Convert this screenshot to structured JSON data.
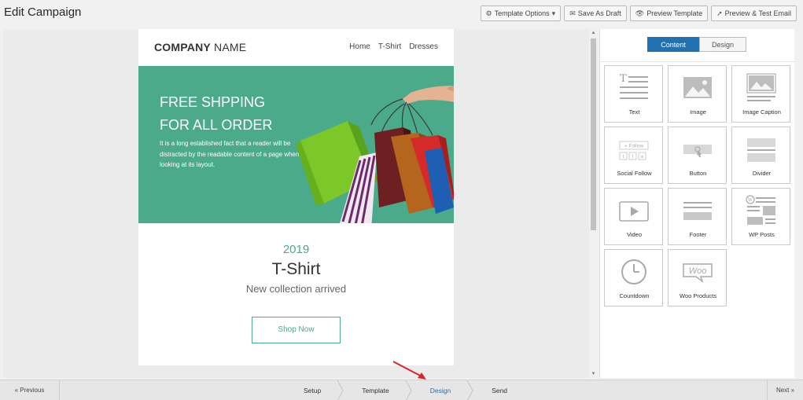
{
  "page": {
    "title": "Edit Campaign"
  },
  "actions": {
    "template_options": "Template Options",
    "save_draft": "Save As Draft",
    "preview_template": "Preview Template",
    "preview_test": "Preview & Test Email"
  },
  "email": {
    "company_bold": "COMPANY",
    "company_rest": " NAME",
    "nav": [
      "Home",
      "T-Shirt",
      "Dresses"
    ],
    "hero_line1": "FREE SHPPING",
    "hero_line2": "FOR ALL ORDER",
    "hero_text": "It is a long established fact that a reader will be distracted by the readable content of a page when looking at its layout.",
    "year": "2019",
    "product": "T-Shirt",
    "subtitle": "New collection arrived",
    "cta": "Shop Now"
  },
  "sidebar": {
    "tabs": [
      "Content",
      "Design"
    ],
    "active_tab": "Content",
    "blocks": [
      {
        "label": "Text",
        "icon": "text-icon"
      },
      {
        "label": "Image",
        "icon": "image-icon"
      },
      {
        "label": "Image Caption",
        "icon": "image-caption-icon"
      },
      {
        "label": "Social Follow",
        "icon": "social-follow-icon"
      },
      {
        "label": "Button",
        "icon": "button-icon"
      },
      {
        "label": "Divider",
        "icon": "divider-icon"
      },
      {
        "label": "Video",
        "icon": "video-icon"
      },
      {
        "label": "Footer",
        "icon": "footer-icon"
      },
      {
        "label": "WP Posts",
        "icon": "wp-posts-icon"
      },
      {
        "label": "Countdown",
        "icon": "countdown-icon"
      },
      {
        "label": "Woo Products",
        "icon": "woo-products-icon"
      }
    ],
    "social_text": "+ Follow"
  },
  "steps": {
    "items": [
      "Setup",
      "Template",
      "Design",
      "Send"
    ],
    "active": "Design",
    "prev": "« Previous",
    "next": "Next »"
  },
  "colors": {
    "accent": "#2271b1",
    "hero_green": "#4aaa8a",
    "annotation_arrow": "#d9262b"
  }
}
